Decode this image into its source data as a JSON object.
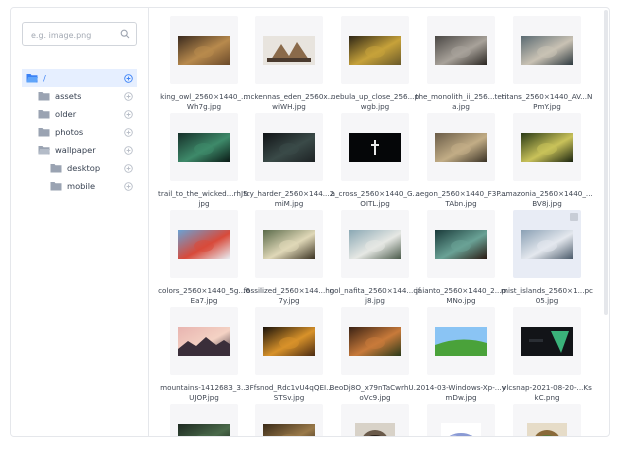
{
  "search": {
    "placeholder": "e.g. image.png",
    "icon": "search-icon"
  },
  "tree": [
    {
      "label": "/",
      "selected": true,
      "level": 0,
      "icon": "folder-open-icon"
    },
    {
      "label": "assets",
      "selected": false,
      "level": 1,
      "icon": "folder-icon"
    },
    {
      "label": "older",
      "selected": false,
      "level": 1,
      "icon": "folder-icon"
    },
    {
      "label": "photos",
      "selected": false,
      "level": 1,
      "icon": "folder-icon"
    },
    {
      "label": "wallpaper",
      "selected": false,
      "level": 1,
      "icon": "folder-open-icon"
    },
    {
      "label": "desktop",
      "selected": false,
      "level": 2,
      "icon": "folder-icon"
    },
    {
      "label": "mobile",
      "selected": false,
      "level": 2,
      "icon": "folder-icon"
    }
  ],
  "files": [
    {
      "name": "king_owl_2560×1440_...Wh7g.jpg",
      "colors": [
        "#3a2a1e",
        "#b88a4d",
        "#6b4a2a"
      ],
      "aspect": "wide"
    },
    {
      "name": "mckennas_eden_2560x...wiWH.jpg",
      "colors": [
        "#e8e4de",
        "#8a6a4a",
        "#4a3a2e"
      ],
      "aspect": "wide-light"
    },
    {
      "name": "nebula_up_close_256...pwgb.jpg",
      "colors": [
        "#2e2616",
        "#c7a23a",
        "#6a5a2a"
      ],
      "aspect": "wide"
    },
    {
      "name": "the_monolith_ii_256...tena.jpg",
      "colors": [
        "#4a4744",
        "#a8a29a",
        "#2a2622"
      ],
      "aspect": "wide"
    },
    {
      "name": "titans_2560×1440_AV...NPmY.jpg",
      "colors": [
        "#5a6a72",
        "#c9c2b4",
        "#2e3a40"
      ],
      "aspect": "wide"
    },
    {
      "name": "trail_to_the_wicked...rhJS.jpg",
      "colors": [
        "#16302a",
        "#3e8a6a",
        "#0a1a16"
      ],
      "aspect": "wide"
    },
    {
      "name": "try_harder_2560×144...2miM.jpg",
      "colors": [
        "#111417",
        "#3a4a48",
        "#1d2224"
      ],
      "aspect": "wide"
    },
    {
      "name": "a_cross_2560×1440_G...OITL.jpg",
      "colors": [
        "#050608",
        "#e8e8e8",
        "#151820"
      ],
      "aspect": "wide-cross"
    },
    {
      "name": "aegon_2560×1440_F3P...TAbn.jpg",
      "colors": [
        "#6a5c48",
        "#c2ad86",
        "#3a3226"
      ],
      "aspect": "wide"
    },
    {
      "name": "amazonia_2560×1440_...BV8j.jpg",
      "colors": [
        "#2a3a16",
        "#c9c25a",
        "#1a2410"
      ],
      "aspect": "wide"
    },
    {
      "name": "colors_2560×1440_5g...6Ea7.jpg",
      "colors": [
        "#6aa2d4",
        "#d84a3a",
        "#e8eef4"
      ],
      "aspect": "wide"
    },
    {
      "name": "fossilized_2560×144...hn7y.jpg",
      "colors": [
        "#5a6a4a",
        "#e0d8b8",
        "#3a3222"
      ],
      "aspect": "wide"
    },
    {
      "name": "gol_nafita_2560×144...qfj8.jpg",
      "colors": [
        "#8aa8b4",
        "#e6e8e4",
        "#4a5a4a"
      ],
      "aspect": "wide"
    },
    {
      "name": "jaianto_2560×1440_2...pMNo.jpg",
      "colors": [
        "#1a3a3a",
        "#6aa296",
        "#2a1a12"
      ],
      "aspect": "wide"
    },
    {
      "name": "mist_islands_2560×1...pc05.jpg",
      "colors": [
        "#8aa0b4",
        "#e4e8ee",
        "#4a5a6a"
      ],
      "aspect": "wide",
      "selected": true
    },
    {
      "name": "mountains-1412683_3...UJOP.jpg",
      "colors": [
        "#e8b4b0",
        "#f4d2c4",
        "#3a2e3a"
      ],
      "aspect": "wide-mtn"
    },
    {
      "name": "3Ffsnod_Rdc1vU4qQEI...STSv.jpg",
      "colors": [
        "#1a120a",
        "#d8922a",
        "#4a2a12"
      ],
      "aspect": "wide"
    },
    {
      "name": "BeoDj8O_x79nTaCwrhU...oVc9.jpg",
      "colors": [
        "#3a2214",
        "#c87a3a",
        "#2a3a1a"
      ],
      "aspect": "wide"
    },
    {
      "name": "2014-03-Windows-Xp-...ymDw.jpg",
      "colors": [
        "#3a7ad8",
        "#4aa23a",
        "#8ac4f4"
      ],
      "aspect": "wide-xp"
    },
    {
      "name": "vlcsnap-2021-08-20-...KskC.png",
      "colors": [
        "#121418",
        "#3ab27a",
        "#2a2e34"
      ],
      "aspect": "wide-vlc"
    },
    {
      "name": "",
      "colors": [
        "#1e2a22",
        "#4a6a4a",
        "#101612"
      ],
      "aspect": "wide"
    },
    {
      "name": "",
      "colors": [
        "#3a2a18",
        "#9a7a4a",
        "#201810"
      ],
      "aspect": "wide"
    },
    {
      "name": "",
      "colors": [
        "#d8d2c8",
        "#6a5a4a",
        "#2a2018"
      ],
      "aspect": "raccoon"
    },
    {
      "name": "",
      "colors": [
        "#ffffff",
        "#8a9ad4",
        "#3a3a5a"
      ],
      "aspect": "hippo"
    },
    {
      "name": "",
      "colors": [
        "#e6dcc8",
        "#8a6a3a",
        "#5a7a3a"
      ],
      "aspect": "animal"
    }
  ]
}
